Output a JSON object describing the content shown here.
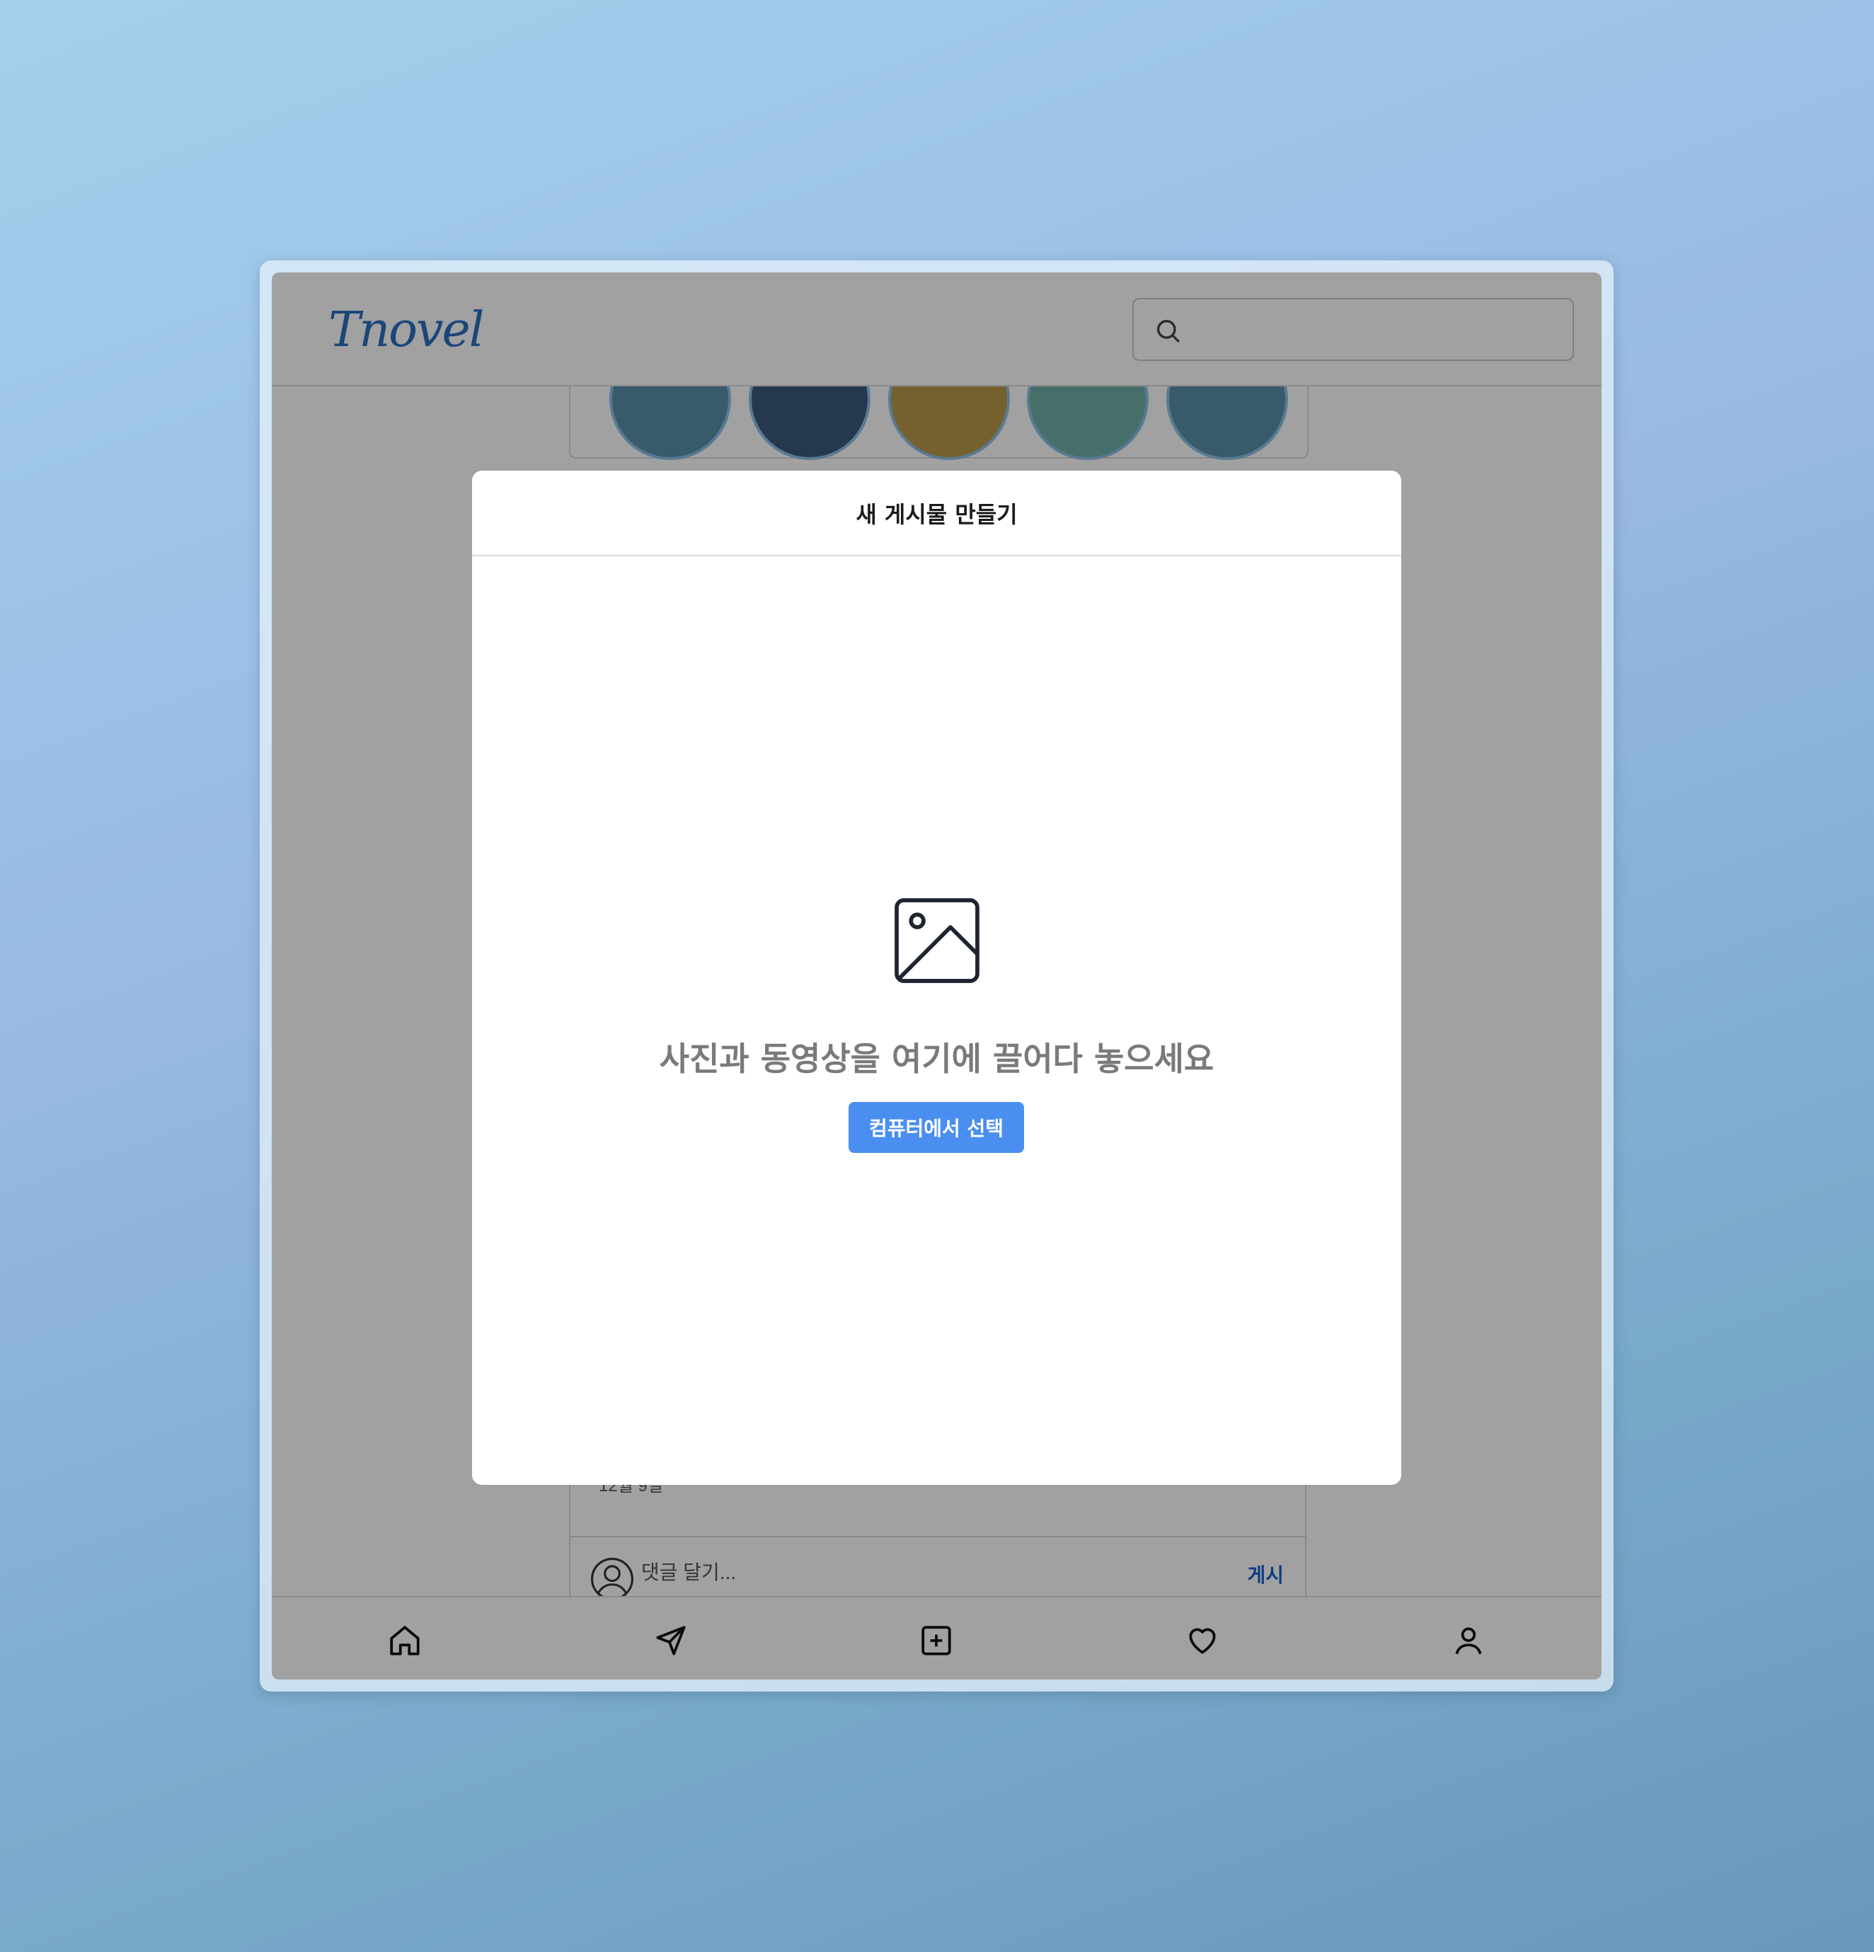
{
  "app": {
    "logo_text": "Tnovel",
    "brand_color": "#2a6fc0"
  },
  "header": {
    "search": {
      "placeholder": "",
      "value": "",
      "icon": "search-icon"
    }
  },
  "feed": {
    "stories_count": 5,
    "post_date": "12월 9일",
    "comment_placeholder": "댓글 달기...",
    "comment_post_label": "게시"
  },
  "bottom_nav": {
    "items": [
      {
        "name": "home",
        "icon": "home-icon"
      },
      {
        "name": "direct",
        "icon": "send-icon"
      },
      {
        "name": "create",
        "icon": "plus-square-icon"
      },
      {
        "name": "activity",
        "icon": "heart-icon"
      },
      {
        "name": "profile",
        "icon": "user-icon"
      }
    ]
  },
  "modal": {
    "title": "새 게시물 만들기",
    "icon": "image-icon",
    "drop_text": "사진과 동영상을 여기에 끌어다 놓으세요",
    "select_button": "컴퓨터에서 선택",
    "button_color": "#4a8ff0"
  }
}
